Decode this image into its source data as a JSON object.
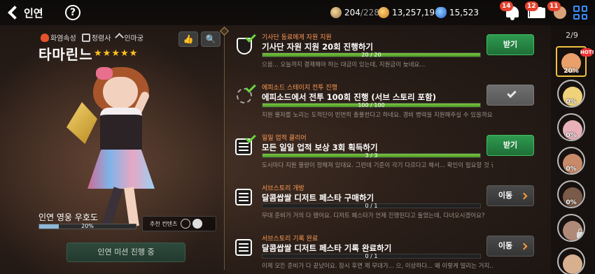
{
  "header": {
    "back_label": "인연",
    "help_label": "?",
    "stamina": {
      "current": "204",
      "max": "/228"
    },
    "gold": "13,257,194",
    "gems": "15,523",
    "badges": {
      "bell": "14",
      "mail": "12",
      "profile": "11"
    }
  },
  "character": {
    "attrs": [
      "화염속성",
      "정령사",
      "인마궁"
    ],
    "name": "타마린느",
    "stars": 5,
    "affinity_label": "인연 영웅 우호도",
    "affinity_pct": "20%",
    "affinity_value": 20,
    "recommend_label": "추천 컨텐츠",
    "mission_button": "인연 미션 진행 중"
  },
  "quests": [
    {
      "category": "기사단 동료에게 자원 지원",
      "title": "기사단 자원 지원 20회 진행하기",
      "progress": "20 / 20",
      "progress_value": 1.0,
      "desc": "으음... 오늘까지 결제해야 하는 대금이 있는데, 지원금이 늦네요...",
      "button": "받기",
      "state": "claim",
      "icon": "shield-icon"
    },
    {
      "category": "에피소드 스테이지 전투 진행",
      "title": "에피소드에서 전투 100회 진행 (서브 스토리 포함)",
      "progress": "100 / 100",
      "progress_value": 1.0,
      "desc": "지원 물자를 노리는 도적단이 빈번히 출몰한다고 하네요. 경비 병력을 지원해주실 수 있을까요?",
      "button": "",
      "state": "done",
      "icon": "swirl-icon"
    },
    {
      "category": "일일 업적 클리어",
      "title": "모든 일일 업적 보상 3회 획득하기",
      "progress": "3 / 3",
      "progress_value": 1.0,
      "desc": "도시마다 지원 물량이 정해져 있대요. 그런데 기준이 각기 다르다고 해서... 확인이 필요할 것 같네요.",
      "button": "받기",
      "state": "claim",
      "icon": "scroll-icon"
    },
    {
      "category": "서브스토리 개방",
      "title": "달콤쌉쌀 디저트 페스타 구매하기",
      "progress": "0 / 1",
      "progress_value": 0,
      "desc": "무대 준비가 거의 다 됐어요. 디저트 페스타가 언제 진행된다고 들었는데, 다녀오시겠어요?",
      "button": "이동",
      "state": "go",
      "icon": "scroll-icon"
    },
    {
      "category": "서브스토리 기록 완료",
      "title": "달콤쌉쌀 디저트 페스타 기록 완료하기",
      "progress": "0 / 1",
      "progress_value": 0,
      "desc": "이제 모든 준비가 다 끝났어요. 잠시 후면 제 무대가... 으, 이상하다... 왜 이렇게 떨리는 거지...",
      "button": "이동",
      "state": "go",
      "icon": "scroll-icon"
    }
  ],
  "sidebar": {
    "page": "2/9",
    "hot_label": "HOT!",
    "avatars": [
      {
        "pct": "20%",
        "color": "#e9a06a",
        "selected": true
      },
      {
        "pct": "0%",
        "color": "#f0d27a"
      },
      {
        "pct": "0%",
        "color": "#e8b0b8"
      },
      {
        "pct": "0%",
        "color": "#c98a6a"
      },
      {
        "pct": "0%",
        "color": "#7a5a48"
      },
      {
        "pct": "",
        "color": "#b08a78",
        "locked": true
      },
      {
        "pct": "",
        "color": "#d8b090"
      }
    ]
  }
}
